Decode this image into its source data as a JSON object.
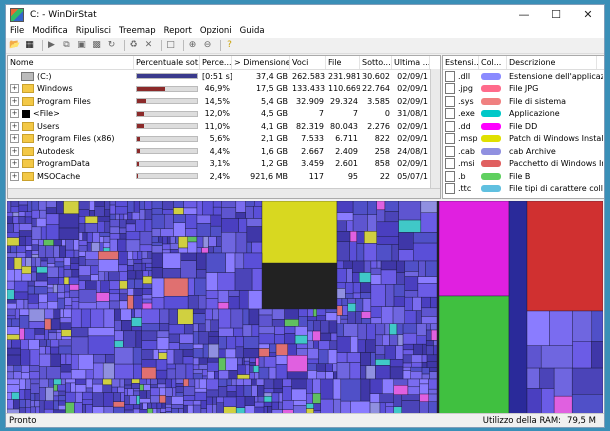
{
  "window": {
    "title": "C: - WinDirStat"
  },
  "menu": [
    "File",
    "Modifica",
    "Ripulisci",
    "Treemap",
    "Report",
    "Opzioni",
    "Guida"
  ],
  "tree": {
    "columns": [
      "Nome",
      "Percentuale sot...",
      "Perce...",
      "> Dimensione",
      "Voci",
      "File",
      "Sotto...",
      "Ultima ..."
    ],
    "rows": [
      {
        "name": "(C:)",
        "percent": "[0:51 s]",
        "size": "37,4 GB",
        "items": "262.583",
        "files": "231.981",
        "subdirs": "30.602",
        "date": "02/09/1",
        "bar": 1.0,
        "icon": "drive"
      },
      {
        "name": "Windows",
        "percent": "46,9%",
        "size": "17,5 GB",
        "items": "133.433",
        "files": "110.669",
        "subdirs": "22.764",
        "date": "02/09/1",
        "bar": 0.469,
        "icon": "folder"
      },
      {
        "name": "Program Files",
        "percent": "14,5%",
        "size": "5,4 GB",
        "items": "32.909",
        "files": "29.324",
        "subdirs": "3.585",
        "date": "02/09/1",
        "bar": 0.145,
        "icon": "folder"
      },
      {
        "name": "<File>",
        "percent": "12,0%",
        "size": "4,5 GB",
        "items": "7",
        "files": "7",
        "subdirs": "0",
        "date": "31/08/1",
        "bar": 0.12,
        "icon": "file"
      },
      {
        "name": "Users",
        "percent": "11,0%",
        "size": "4,1 GB",
        "items": "82.319",
        "files": "80.043",
        "subdirs": "2.276",
        "date": "02/09/1",
        "bar": 0.11,
        "icon": "folder"
      },
      {
        "name": "Program Files (x86)",
        "percent": "5,6%",
        "size": "2,1 GB",
        "items": "7.533",
        "files": "6.711",
        "subdirs": "822",
        "date": "02/09/1",
        "bar": 0.056,
        "icon": "folder"
      },
      {
        "name": "Autodesk",
        "percent": "4,4%",
        "size": "1,6 GB",
        "items": "2.667",
        "files": "2.409",
        "subdirs": "258",
        "date": "24/08/1",
        "bar": 0.044,
        "icon": "folder"
      },
      {
        "name": "ProgramData",
        "percent": "3,1%",
        "size": "1,2 GB",
        "items": "3.459",
        "files": "2.601",
        "subdirs": "858",
        "date": "02/09/1",
        "bar": 0.031,
        "icon": "folder"
      },
      {
        "name": "MSOCache",
        "percent": "2,4%",
        "size": "921,6 MB",
        "items": "117",
        "files": "95",
        "subdirs": "22",
        "date": "05/07/1",
        "bar": 0.024,
        "icon": "folder"
      }
    ]
  },
  "ext": {
    "columns": [
      "Estensi...",
      "Col...",
      "Descrizione"
    ],
    "rows": [
      {
        "ext": ".dll",
        "color": "#8a8aff",
        "desc": "Estensione dell'applicazio"
      },
      {
        "ext": ".jpg",
        "color": "#ff6b8b",
        "desc": "File JPG"
      },
      {
        "ext": ".sys",
        "color": "#f08080",
        "desc": "File di sistema"
      },
      {
        "ext": ".exe",
        "color": "#00c8c8",
        "desc": "Applicazione"
      },
      {
        "ext": ".dd",
        "color": "#ff00ff",
        "desc": "File DD"
      },
      {
        "ext": ".msp",
        "color": "#e0e000",
        "desc": "Patch di Windows Installe"
      },
      {
        "ext": ".cab",
        "color": "#9090e0",
        "desc": "cab Archive"
      },
      {
        "ext": ".msi",
        "color": "#e06060",
        "desc": "Pacchetto di Windows In"
      },
      {
        "ext": ".b",
        "color": "#60d060",
        "desc": "File B"
      },
      {
        "ext": ".ttc",
        "color": "#60c0e0",
        "desc": "File tipi di carattere colle"
      }
    ]
  },
  "status": {
    "left": "Pronto",
    "ram_label": "Utilizzo della RAM:",
    "ram_value": "79,5 M"
  },
  "colors": {
    "bar": "#8b2a2a",
    "root_bar": "#3a3a8c",
    "accent": "#3a8fb7"
  }
}
